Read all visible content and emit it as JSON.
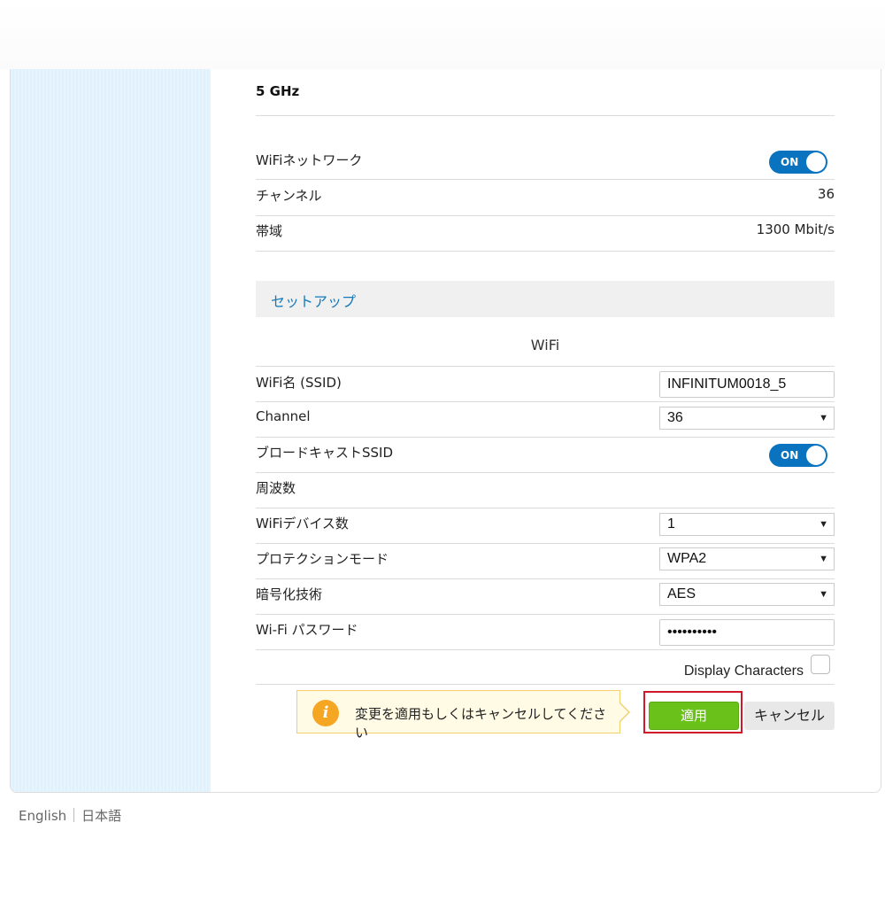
{
  "band": {
    "title": "5 GHz"
  },
  "status": {
    "wifi_network_label": "WiFiネットワーク",
    "wifi_network_toggle": "ON",
    "channel_label": "チャンネル",
    "channel_value": "36",
    "bandwidth_label": "帯域",
    "bandwidth_value": "1300 Mbit/s"
  },
  "setup": {
    "title": "セットアップ",
    "section_title": "WiFi",
    "ssid_label": "WiFi名 (SSID)",
    "ssid_value": "INFINITUM0018_5",
    "channel_label": "Channel",
    "channel_selected": "36",
    "broadcast_ssid_label": "ブロードキャストSSID",
    "broadcast_ssid_toggle": "ON",
    "frequency_label": "周波数",
    "device_count_label": "WiFiデバイス数",
    "device_count_selected": "1",
    "protection_mode_label": "プロテクションモード",
    "protection_mode_selected": "WPA2",
    "encryption_label": "暗号化技術",
    "encryption_selected": "AES",
    "password_label": "Wi-Fi パスワード",
    "password_value": "••••••••••",
    "display_characters_label": "Display Characters"
  },
  "actions": {
    "notice_text": "変更を適用もしくはキャンセルしてください",
    "apply_label": "適用",
    "cancel_label": "キャンセル"
  },
  "footer": {
    "lang_english": "English",
    "lang_japanese": "日本語"
  },
  "colors": {
    "toggle_on": "#0a73bf",
    "apply_green": "#6ac11a",
    "highlight_red": "#d0182b",
    "sidebar_blue": "#e6f4fd",
    "link_blue": "#1479b8"
  },
  "icons": {
    "notice_icon": "info-icon",
    "select_caret": "caret-down-icon"
  }
}
